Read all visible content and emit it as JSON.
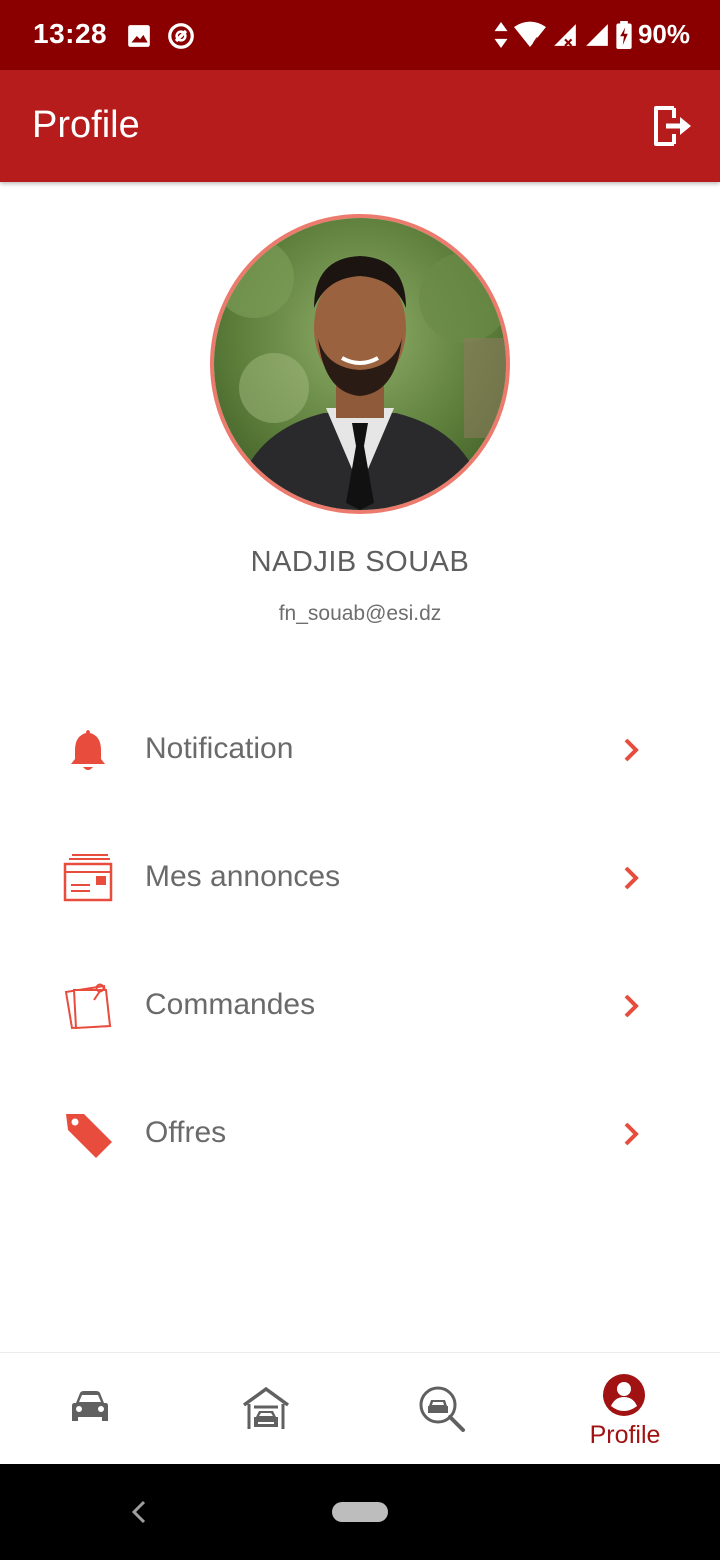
{
  "status_bar": {
    "time": "13:28",
    "battery": "90%",
    "icons": [
      "image-icon",
      "data-saver-icon",
      "data-arrows-icon",
      "wifi-icon",
      "signal-icon",
      "signal-noservice-icon",
      "battery-charging-icon"
    ]
  },
  "app_bar": {
    "title": "Profile",
    "logout_icon": "logout-icon"
  },
  "profile": {
    "name": "NADJIB SOUAB",
    "email": "fn_souab@esi.dz"
  },
  "menu": {
    "items": [
      {
        "label": "Notification",
        "icon": "bell-icon"
      },
      {
        "label": "Mes annonces",
        "icon": "ads-icon"
      },
      {
        "label": "Commandes",
        "icon": "orders-icon"
      },
      {
        "label": "Offres",
        "icon": "tag-icon"
      }
    ]
  },
  "bottom_nav": {
    "items": [
      {
        "icon": "car-icon",
        "label": ""
      },
      {
        "icon": "garage-icon",
        "label": ""
      },
      {
        "icon": "car-search-icon",
        "label": ""
      },
      {
        "icon": "profile-icon",
        "label": "Profile"
      }
    ],
    "active_index": 3
  },
  "colors": {
    "status_bar": "#8a0000",
    "app_bar": "#b71c1c",
    "accent": "#e84c3d",
    "active_nav": "#a11313",
    "text": "#6a6a6a"
  }
}
